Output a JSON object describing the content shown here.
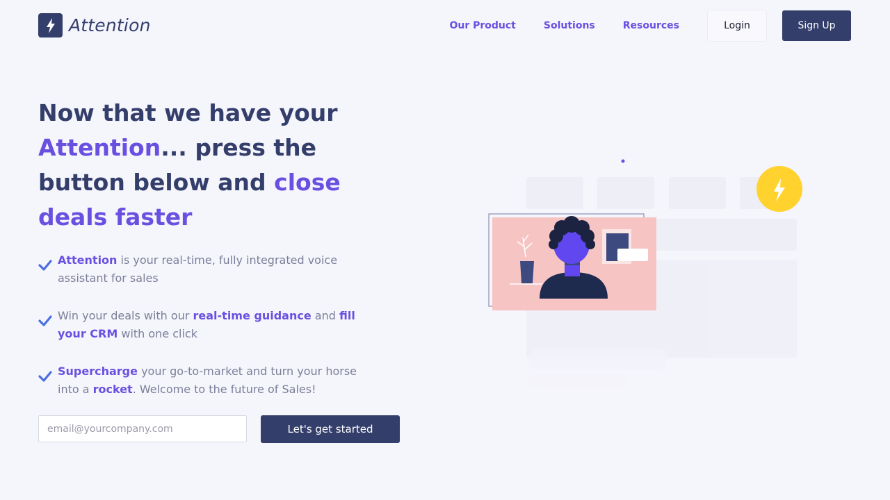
{
  "brand": {
    "name": "Attention"
  },
  "nav": {
    "links": [
      "Our Product",
      "Solutions",
      "Resources"
    ],
    "login_label": "Login",
    "signup_label": "Sign Up"
  },
  "hero": {
    "line1": "Now that we have your",
    "accent1": "Attention",
    "mid": "... press the button below and ",
    "accent2": "close deals faster"
  },
  "bullets": [
    {
      "b1": "Attention",
      "t1": " is your real-time, fully integrated voice assistant for sales"
    },
    {
      "t0": "Win your deals with our ",
      "b1": "real-time guidance",
      "t1": " and ",
      "b2": "fill your CRM",
      "t2": " with one click"
    },
    {
      "b1": "Supercharge",
      "t1": " your go-to-market and turn your horse into a ",
      "b2": "rocket",
      "t2": ". Welcome to the future of Sales!"
    }
  ],
  "form": {
    "email_placeholder": "email@yourcompany.com",
    "cta_label": "Let's get started"
  },
  "icons": {
    "logo": "lightning-bolt-icon",
    "check": "checkmark-icon",
    "badge": "lightning-bolt-icon"
  },
  "colors": {
    "brand_navy": "#343e6b",
    "accent_purple": "#6950e0",
    "check_blue": "#4a6fe0",
    "badge_yellow": "#ffd22e",
    "card_pink": "#f7c4c4"
  }
}
